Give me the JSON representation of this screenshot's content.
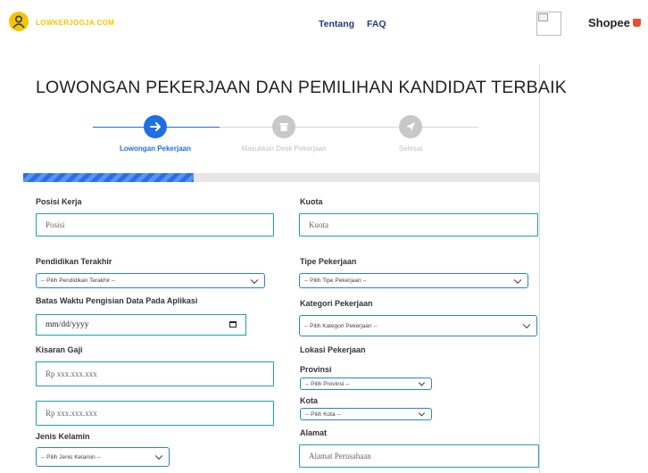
{
  "navbar": {
    "brand": "LOWKERJOGJA.COM",
    "links": [
      "Tentang",
      "FAQ"
    ],
    "shopee_text": "Shopee"
  },
  "page": {
    "title": "LOWONGAN PEKERJAAN DAN PEMILIHAN KANDIDAT TERBAIK"
  },
  "stepper": {
    "steps": [
      {
        "label": "Lowongan Pekerjaan",
        "icon": "arrow-right-icon",
        "active": true
      },
      {
        "label": "Masukkan Desk Pekerjaan",
        "icon": "folder-icon",
        "active": false
      },
      {
        "label": "Selesai",
        "icon": "paper-plane-icon",
        "active": false
      }
    ],
    "active_color": "#1e6fe6",
    "inactive_color": "#c8c8c8"
  },
  "progress": {
    "value": 0.33
  },
  "form": {
    "posisi": {
      "label": "Posisi Kerja",
      "placeholder": "Posisi"
    },
    "kuota": {
      "label": "Kuota",
      "placeholder": "Kuota"
    },
    "pendidikan": {
      "label": "Pendidikan Terakhir",
      "selected": "-- Pilih Pendidikan Terakhir --"
    },
    "tipe": {
      "label": "Tipe Pekerjaan",
      "selected": "-- Pilih Tipe Pekerjaan --"
    },
    "batas": {
      "label": "Batas Waktu Pengisian Data Pada Aplikasi",
      "value": "mm/dd/yyyy"
    },
    "kategori": {
      "label": "Kategori Pekerjaan",
      "selected": "-- Pilih Kategori Pekerjaan --"
    },
    "gaji": {
      "label": "Kisaran Gaji",
      "min_placeholder": "Rp xxx.xxx.xxx",
      "max_placeholder": "Rp xxx.xxx.xxx"
    },
    "lokasi": {
      "label": "Lokasi Pekerjaan"
    },
    "provinsi": {
      "label": "Provinsi",
      "selected": "-- Pilih Provinsi --"
    },
    "kota": {
      "label": "Kota",
      "selected": "-- Pilih Kota --"
    },
    "jenis_kelamin": {
      "label": "Jenis Kelamin",
      "selected": "-- Pilih Jenis Kelamin --"
    },
    "alamat": {
      "label": "Alamat",
      "placeholder": "Alamat Perusahaan"
    }
  }
}
